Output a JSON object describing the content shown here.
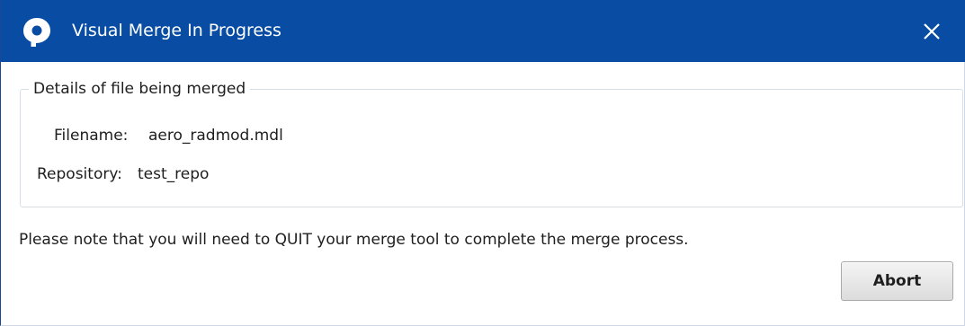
{
  "window": {
    "title": "Visual Merge In Progress",
    "accent_color": "#084da3",
    "app_icon": "location-pin-icon",
    "close_icon": "close-icon"
  },
  "details_group": {
    "legend": "Details of file being merged",
    "filename_label": "Filename:",
    "filename_value": "aero_radmod.mdl",
    "repository_label": "Repository:",
    "repository_value": "test_repo"
  },
  "note": "Please note that you will need to QUIT your merge tool to complete the merge process.",
  "buttons": {
    "abort_label": "Abort"
  }
}
